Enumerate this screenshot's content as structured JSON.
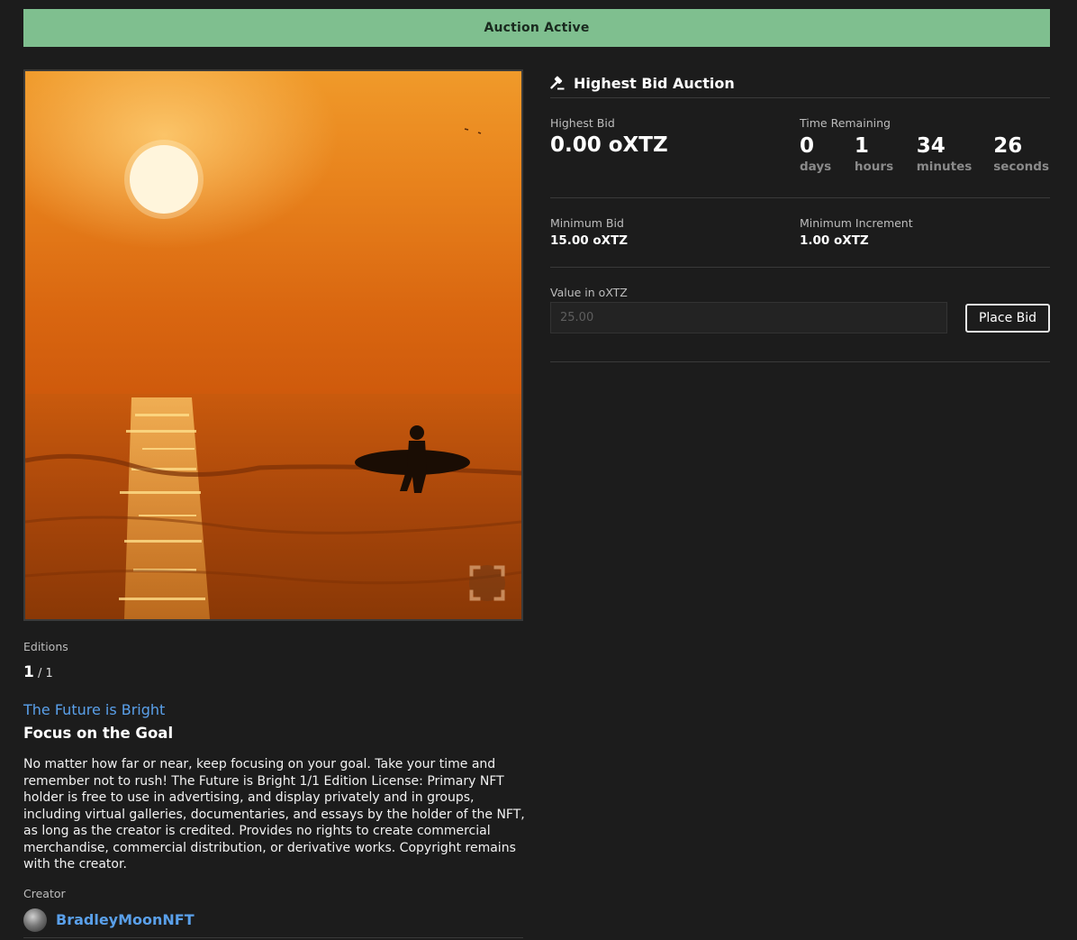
{
  "banner": {
    "status": "Auction Active"
  },
  "artwork": {
    "icon": "fullscreen-icon"
  },
  "editions": {
    "label": "Editions",
    "current": "1",
    "total": " / 1"
  },
  "collection": {
    "name": "The Future is Bright"
  },
  "token": {
    "title": "Focus on the Goal",
    "description": "No matter how far or near, keep focusing on your goal. Take your time and remember not to rush! The Future is Bright 1/1 Edition License: Primary NFT holder is free to use in advertising, and display privately and in groups, including virtual galleries, documentaries, and essays by the holder of the NFT, as long as the creator is credited. Provides no rights to create commercial merchandise, commercial distribution, or derivative works. Copyright remains with the creator."
  },
  "creator": {
    "label": "Creator",
    "name": "BradleyMoonNFT"
  },
  "auction": {
    "header_icon": "gavel-icon",
    "title": "Highest Bid Auction",
    "highest_bid_label": "Highest Bid",
    "highest_bid": "0.00 oXTZ",
    "time_remaining_label": "Time Remaining",
    "countdown": [
      {
        "value": "0",
        "unit": "days"
      },
      {
        "value": "1",
        "unit": "hours"
      },
      {
        "value": "34",
        "unit": "minutes"
      },
      {
        "value": "26",
        "unit": "seconds"
      }
    ],
    "minimum_bid_label": "Minimum Bid",
    "minimum_bid": "15.00 oXTZ",
    "minimum_increment_label": "Minimum Increment",
    "minimum_increment": "1.00 oXTZ",
    "value_label": "Value in oXTZ",
    "value_placeholder": "25.00",
    "place_bid_label": "Place Bid"
  }
}
